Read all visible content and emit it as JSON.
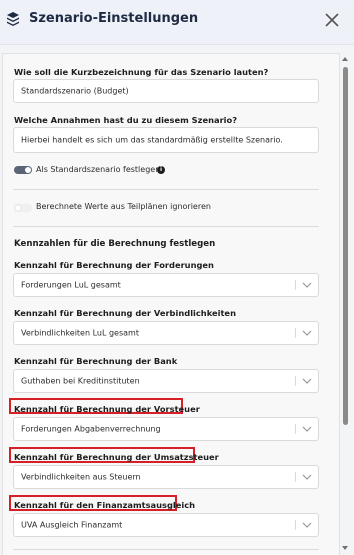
{
  "header": {
    "title": "Szenario-Einstellungen",
    "icon": "layers-icon",
    "close_icon": "close-icon"
  },
  "form": {
    "short_name": {
      "label": "Wie soll die Kurzbezeichnung für das Szenario lauten?",
      "value": "Standardszenario (Budget)"
    },
    "assumptions": {
      "label": "Welche Annahmen hast du zu diesem Szenario?",
      "value": "Hierbei handelt es sich um das standardmäßig erstellte Szenario."
    },
    "default_toggle": {
      "label": "Als Standardszenario festlegen",
      "state": "on"
    },
    "ignore_toggle": {
      "label": "Berechnete Werte aus Teilplänen ignorieren",
      "state": "off"
    },
    "section_title": "Kennzahlen für die Berechnung festlegen",
    "selects": [
      {
        "label": "Kennzahl für Berechnung der Forderungen",
        "value": "Forderungen LuL gesamt",
        "highlighted": false
      },
      {
        "label": "Kennzahl für Berechnung der Verbindlichkeiten",
        "value": "Verbindlichkeiten LuL gesamt",
        "highlighted": false
      },
      {
        "label": "Kennzahl für Berechnung der Bank",
        "value": "Guthaben bei Kreditinstituten",
        "highlighted": false
      },
      {
        "label": "Kennzahl für Berechnung der Vorsteuer",
        "value": "Forderungen Abgabenverrechnung",
        "highlighted": true
      },
      {
        "label": "Kennzahl für Berechnung der Umsatzsteuer",
        "value": "Verbindlichkeiten aus Steuern",
        "highlighted": true
      },
      {
        "label": "Kennzahl für den Finanzamtsausgleich",
        "value": "UVA Ausgleich Finanzamt",
        "highlighted": true
      }
    ]
  },
  "colors": {
    "highlight": "#d61f26",
    "toggle_on": "#5b6578"
  }
}
